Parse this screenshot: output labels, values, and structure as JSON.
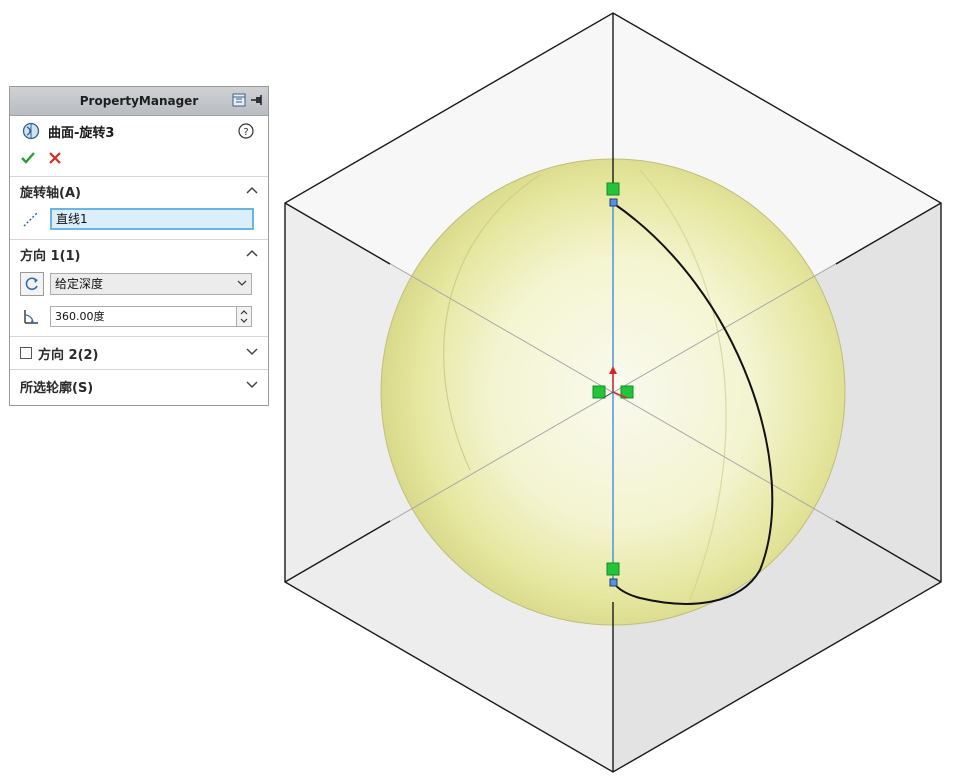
{
  "panel": {
    "header_title": "PropertyManager",
    "feature_name": "曲面-旋转3",
    "sections": {
      "axis": {
        "title": "旋转轴(A)",
        "value": "直线1"
      },
      "direction1": {
        "title": "方向 1(1)",
        "end_condition": "给定深度",
        "angle": "360.00度"
      },
      "direction2": {
        "title": "方向 2(2)",
        "checked": false
      },
      "profiles": {
        "title": "所选轮廓(S)"
      }
    }
  },
  "icons": {
    "header": [
      "pin-icon",
      "panel-options-icon"
    ],
    "feature": "surface-revolve-icon",
    "help": "help-icon",
    "ok": "checkmark-icon",
    "cancel": "cancel-x-icon",
    "axis": "axis-line-icon",
    "direction": "reverse-direction-icon",
    "angle": "angle-icon"
  },
  "colors": {
    "accent_ok": "#2e9d36",
    "accent_cancel": "#d62b1f",
    "selected_field": "#dbeefb",
    "sphere": "#eef0a8",
    "sketch_line": "#3f8fdc",
    "relation_marker": "#23c43a"
  }
}
